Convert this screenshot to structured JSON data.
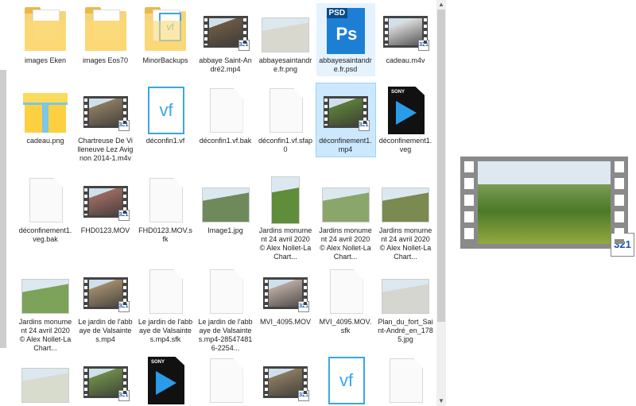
{
  "files": [
    {
      "name": "images Eken",
      "type": "folder"
    },
    {
      "name": "images Eos70",
      "type": "folder"
    },
    {
      "name": "MinorBackups",
      "type": "vf-folder"
    },
    {
      "name": "abbaye Saint-André2.mp4",
      "type": "video",
      "color": "#6b5a44"
    },
    {
      "name": "abbayesaintandre.fr.png",
      "type": "image",
      "color": "#d9d8cf"
    },
    {
      "name": "abbayesaintandre.fr.psd",
      "type": "psd",
      "state": "hover"
    },
    {
      "name": "cadeau.m4v",
      "type": "video",
      "color": "#d8d8d8"
    },
    {
      "name": "cadeau.png",
      "type": "gift"
    },
    {
      "name": "Chartreuse De Villeneuve Lez Avignon 2014-1.m4v",
      "type": "video",
      "color": "#8b7a60"
    },
    {
      "name": "déconfin1.vf",
      "type": "vf-file"
    },
    {
      "name": "déconfin1.vf.bak",
      "type": "blank"
    },
    {
      "name": "déconfin1.vf.sfap0",
      "type": "blank"
    },
    {
      "name": "déconfinement1.mp4",
      "type": "video",
      "color": "#5d7d3a",
      "state": "selected"
    },
    {
      "name": "déconfinement1.veg",
      "type": "sony"
    },
    {
      "name": "déconfinement1.veg.bak",
      "type": "blank"
    },
    {
      "name": "FHD0123.MOV",
      "type": "video",
      "color": "#9a6a60"
    },
    {
      "name": "FHD0123.MOV.sfk",
      "type": "blank"
    },
    {
      "name": "Image1.jpg",
      "type": "image",
      "color": "#6e8a5a"
    },
    {
      "name": "Jardins monument 24 avril 2020 © Alex Nollet-La Chart...",
      "type": "image",
      "color": "#5f8d3a",
      "tall": true
    },
    {
      "name": "Jardins monument 24 avril 2020 © Alex Nollet-La Chart...",
      "type": "image",
      "color": "#8aa66a"
    },
    {
      "name": "Jardins monument 24 avril 2020 © Alex Nollet-La Chart...",
      "type": "image",
      "color": "#7a8a50"
    },
    {
      "name": "Jardins monument 24 avril 2020 © Alex Nollet-La Chart...",
      "type": "image",
      "color": "#7da35a"
    },
    {
      "name": "Le jardin de l'abbaye de Valsaintes.mp4",
      "type": "video",
      "color": "#a08a6a"
    },
    {
      "name": "Le jardin de l'abbaye de Valsaintes.mp4.sfk",
      "type": "blank"
    },
    {
      "name": "Le jardin de l'abbaye de Valsaintes.mp4-285474816-2254...",
      "type": "blank"
    },
    {
      "name": "MVI_4095.MOV",
      "type": "video",
      "color": "#b8a8a0"
    },
    {
      "name": "MVI_4095.MOV.sfk",
      "type": "blank"
    },
    {
      "name": "Plan_du_fort_Saint-André_en_1785.jpg",
      "type": "image",
      "color": "#d6d6d0"
    },
    {
      "name": "",
      "type": "image",
      "color": "#d8dccc"
    },
    {
      "name": "",
      "type": "video",
      "color": "#6e8a4a"
    },
    {
      "name": "",
      "type": "sony"
    },
    {
      "name": "",
      "type": "blank"
    },
    {
      "name": "",
      "type": "video",
      "color": "#8a7a60"
    },
    {
      "name": "",
      "type": "vf-file"
    },
    {
      "name": "",
      "type": "blank"
    }
  ],
  "badge_321": "321",
  "psd_label": "PSD",
  "psd_glyph": "Ps",
  "vf_glyph": "vf",
  "sony_label": "SONY",
  "scroll": {
    "up": "▲",
    "down": "▼"
  }
}
